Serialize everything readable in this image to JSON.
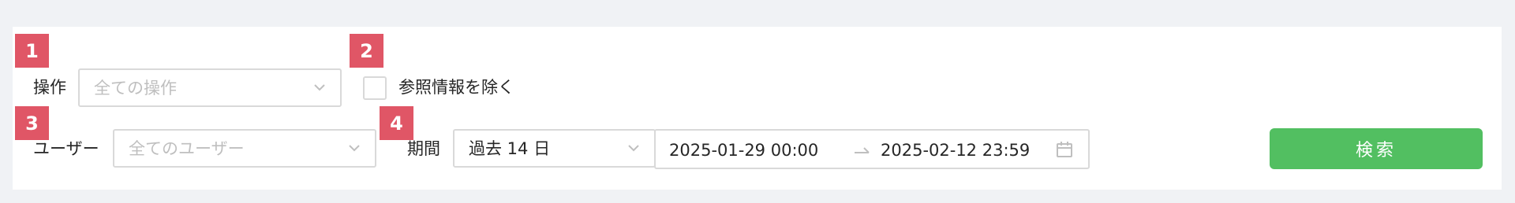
{
  "filters": {
    "operation": {
      "badge": "1",
      "label": "操作",
      "placeholder": "全ての操作"
    },
    "exclude_reference": {
      "badge": "2",
      "label": "参照情報を除く",
      "checked": false
    },
    "user": {
      "badge": "3",
      "label": "ユーザー",
      "placeholder": "全てのユーザー"
    },
    "period": {
      "badge": "4",
      "label": "期間",
      "selected": "過去 14 日",
      "start": "2025-01-29 00:00",
      "end": "2025-02-12 23:59"
    },
    "search_label": "検索"
  },
  "colors": {
    "badge": "#e05666",
    "search_button": "#52bf61",
    "border": "#d9d9d9",
    "placeholder": "#bfbfbf",
    "background": "#f0f2f5"
  },
  "icons": {
    "select_arrow": "chevron-down-icon",
    "range_separator": "arrow-right-icon",
    "date_picker": "calendar-icon"
  }
}
